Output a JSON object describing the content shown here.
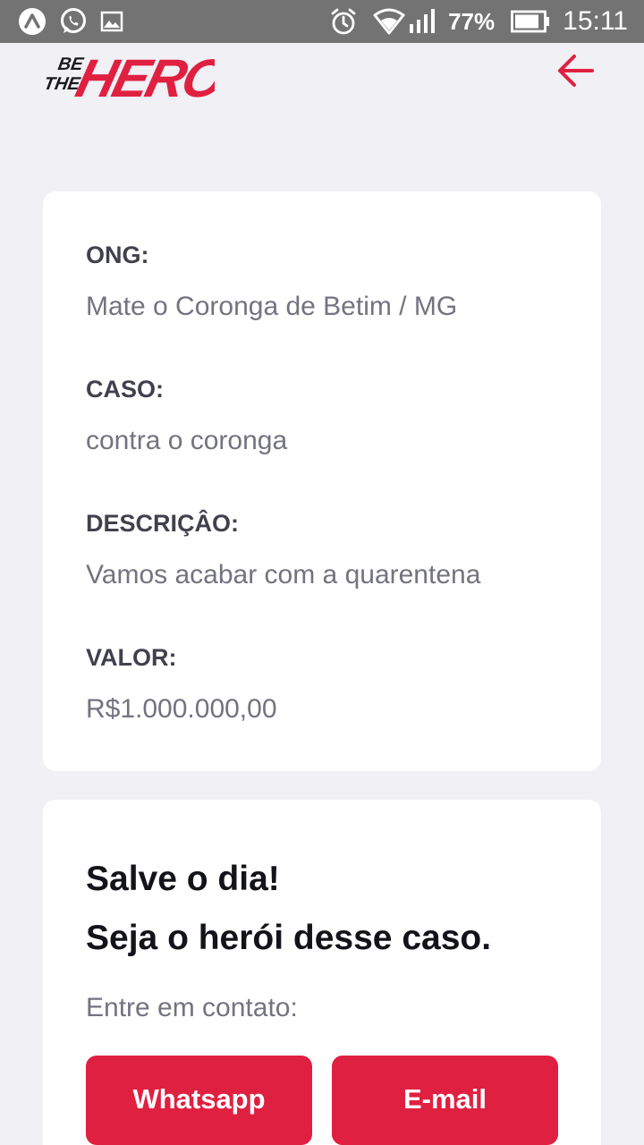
{
  "status_bar": {
    "battery_percent": "77%",
    "time": "15:11",
    "icons": [
      "app-a-icon",
      "whatsapp-icon",
      "image-icon",
      "alarm-icon",
      "wifi-icon",
      "signal-icon",
      "battery-icon"
    ]
  },
  "header": {
    "logo_text": "BE THE HERO",
    "back_icon": "arrow-left-icon"
  },
  "incident": {
    "ong_label": "ONG:",
    "ong_value": "Mate o Coronga de Betim / MG",
    "case_label": "CASO:",
    "case_value": "contra o coronga",
    "description_label": "DESCRIÇÂO:",
    "description_value": "Vamos acabar com a quarentena",
    "value_label": "VALOR:",
    "value_value": "R$1.000.000,00"
  },
  "contact": {
    "title_line1": "Salve o dia!",
    "title_line2": "Seja o herói desse caso.",
    "description": "Entre em contato:",
    "whatsapp_label": "Whatsapp",
    "email_label": "E-mail"
  },
  "colors": {
    "brand": "#e02041",
    "background": "#f0f0f5",
    "status_bar": "#737373",
    "label": "#41414d",
    "value": "#737380",
    "title": "#13131a"
  }
}
